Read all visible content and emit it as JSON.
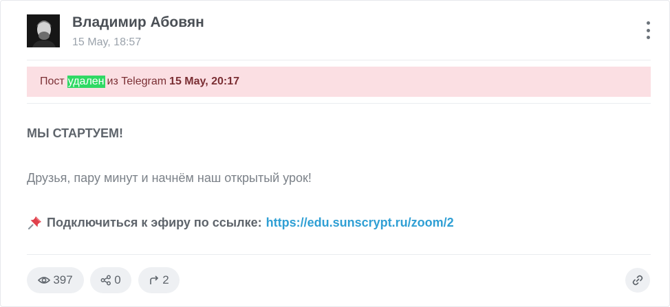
{
  "post": {
    "author": "Владимир Абовян",
    "date": "15 May, 18:57",
    "avatar_icon": "author-portrait",
    "menu_icon": "vertical-dots-icon"
  },
  "alert": {
    "prefix": "Пост",
    "highlight": "удален",
    "middle": "из Telegram",
    "when": "15 May, 20:17",
    "background": "#fbdfe3",
    "highlight_color": "#2fd964"
  },
  "content": {
    "title": "МЫ СТАРТУЕМ!",
    "text": "Друзья, пару минут и начнём наш открытый урок!",
    "pin_icon": "pushpin-icon",
    "link_label": "Подключиться к эфиру по ссылке:",
    "link_url": "https://edu.sunscrypt.ru/zoom/2",
    "link_color": "#2f9fd4"
  },
  "stats": {
    "views": "397",
    "shares": "0",
    "forwards": "2",
    "views_icon": "eye-icon",
    "shares_icon": "share-icon",
    "forwards_icon": "forward-arrow-icon",
    "link_icon": "chain-link-icon"
  }
}
